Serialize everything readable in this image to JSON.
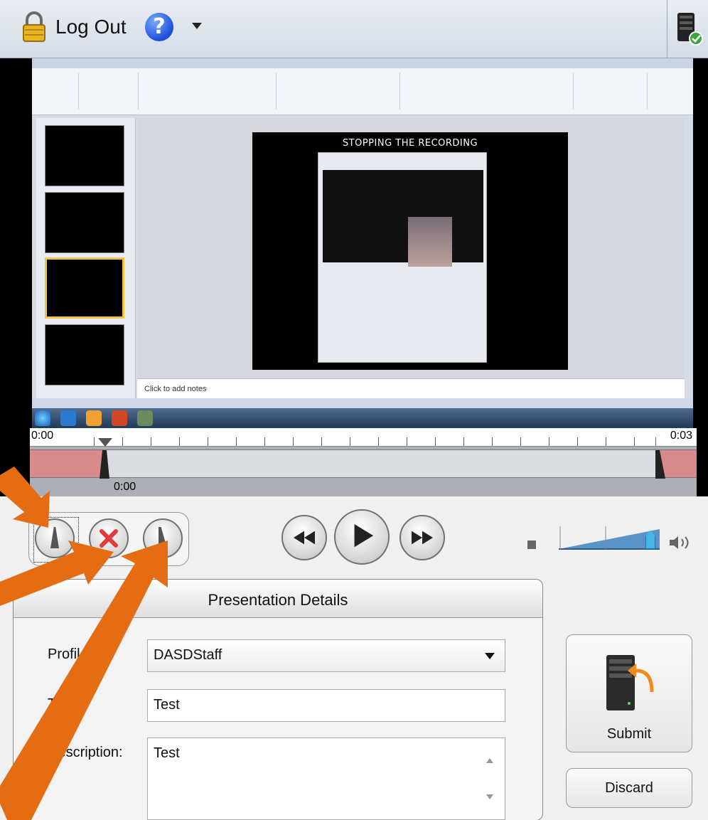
{
  "toolbar": {
    "logout_label": "Log Out",
    "help_glyph": "?",
    "icons": [
      "lock-icon",
      "help-icon",
      "dropdown-caret-icon",
      "server-status-icon"
    ]
  },
  "capture": {
    "slide_title": "STOPPING THE RECORDING",
    "notes_placeholder": "Click to add notes"
  },
  "timeline": {
    "start": "0:00",
    "end": "0:03",
    "current": "0:00"
  },
  "details": {
    "title": "Presentation Details",
    "profile_label": "Profile:",
    "profile_value": "DASDStaff",
    "title_label": "Title:",
    "title_value": "Test",
    "description_label": "Description:",
    "description_value": "Test"
  },
  "actions": {
    "submit_label": "Submit",
    "discard_label": "Discard"
  },
  "volume": {
    "level": 0.92
  },
  "colors": {
    "annotation_arrow": "#e46d14",
    "trim_region": "#d98a8d",
    "volume_knob": "#46b6e8"
  }
}
